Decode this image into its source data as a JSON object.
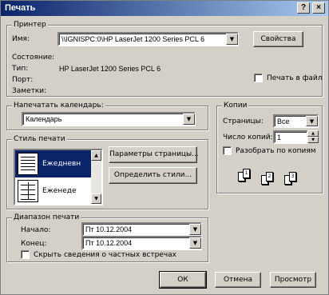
{
  "window": {
    "title": "Печать"
  },
  "titlebar": {
    "help_label": "?",
    "close_label": "×"
  },
  "printer": {
    "legend": "Принтер",
    "name_label": "Имя:",
    "name_value": "\\\\IGNISPC:0\\HP LaserJet 1200 Series PCL 6",
    "properties_label": "Свойства",
    "status_label": "Состояние:",
    "type_label": "Тип:",
    "type_value": "HP LaserJet 1200 Series PCL 6",
    "port_label": "Порт:",
    "comment_label": "Заметки:",
    "print_to_file_label": "Печать в файл",
    "print_to_file_checked": false
  },
  "calendar": {
    "legend": "Напечатать календарь:",
    "value": "Календарь"
  },
  "print_style": {
    "legend": "Стиль печати",
    "styles": [
      {
        "name": "Ежедневн"
      },
      {
        "name": "Еженеде"
      }
    ],
    "page_setup_label": "Параметры страницы...",
    "define_styles_label": "Определить стили..."
  },
  "copies": {
    "legend": "Копии",
    "pages_label": "Страницы:",
    "pages_value": "Все",
    "count_label": "Число копий:",
    "count_value": "1",
    "collate_label": "Разобрать по копиям",
    "collate_checked": false,
    "collate_pages": [
      "1",
      "2",
      "3"
    ]
  },
  "range": {
    "legend": "Диапазон печати",
    "start_label": "Начало:",
    "start_value": "Пт 10.12.2004",
    "end_label": "Конец:",
    "end_value": "Пт 10.12.2004",
    "hide_private_label": "Скрыть сведения о частных встречах",
    "hide_private_checked": false
  },
  "footer": {
    "ok_label": "ОК",
    "cancel_label": "Отмена",
    "preview_label": "Просмотр"
  },
  "icons": {
    "dropdown": "triangle-down",
    "spin_up": "triangle-up",
    "spin_down": "triangle-down"
  }
}
